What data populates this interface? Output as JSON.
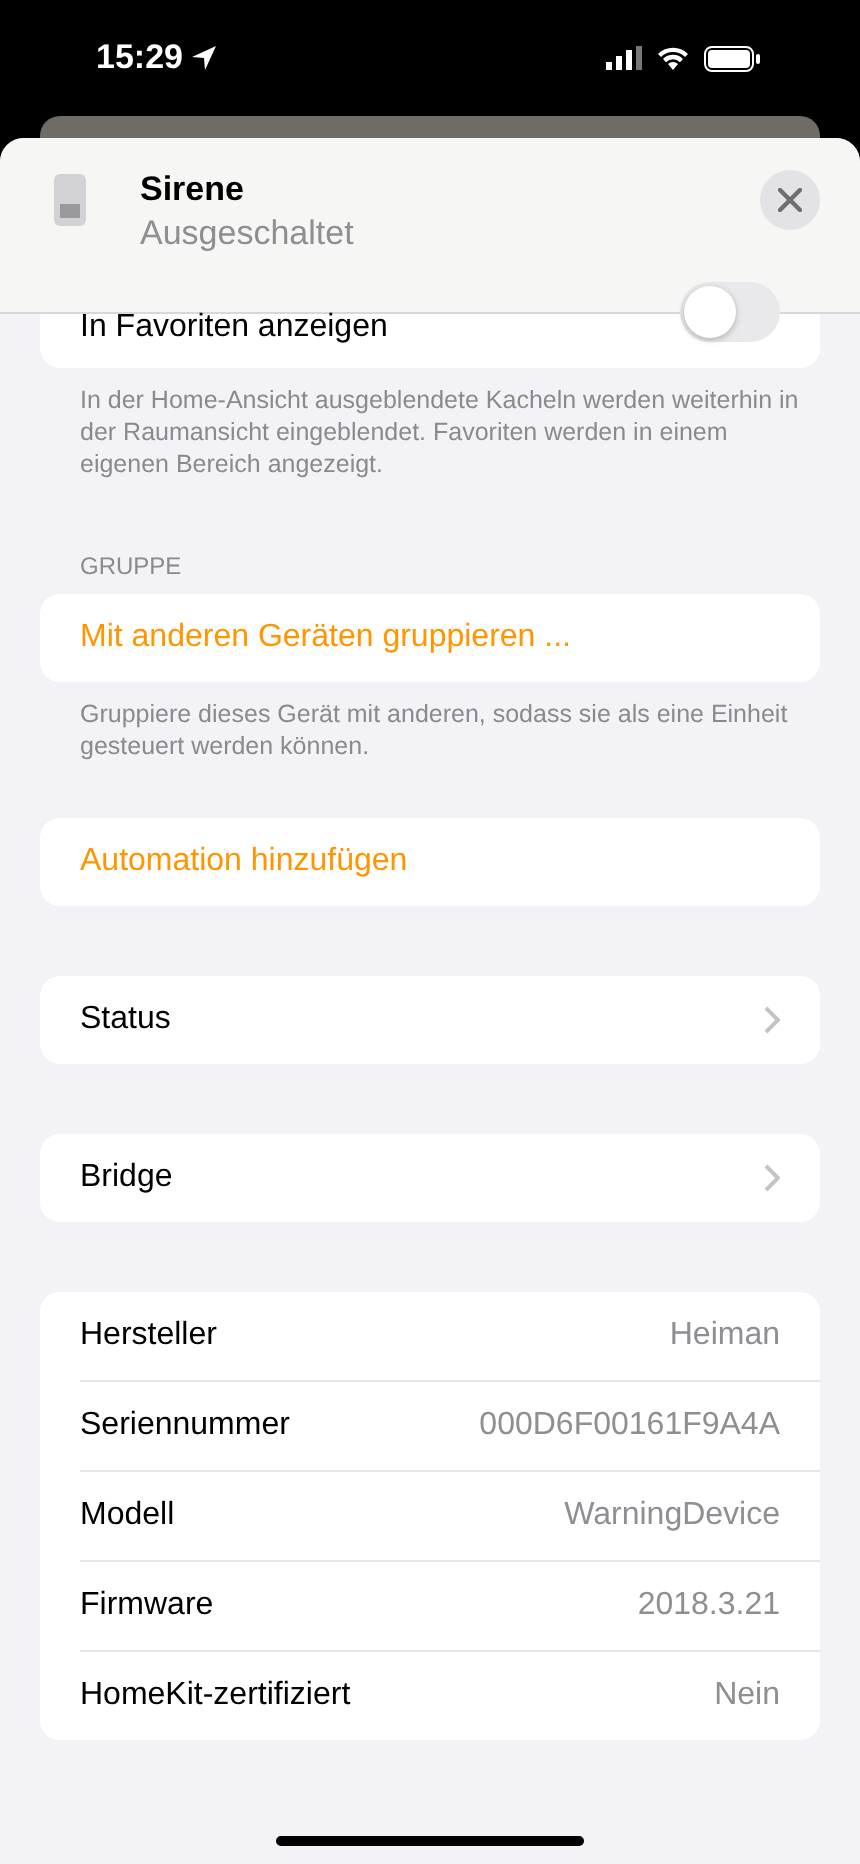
{
  "status_bar": {
    "time": "15:29"
  },
  "header": {
    "title": "Sirene",
    "subtitle": "Ausgeschaltet"
  },
  "favorites": {
    "label": "In Favoriten anzeigen",
    "on": false,
    "footnote": "In der Home-Ansicht ausgeblendete Kacheln werden weiterhin in der Raumansicht eingeblendet. Favoriten werden in einem eigenen Bereich angezeigt."
  },
  "group": {
    "heading": "GRUPPE",
    "action": "Mit anderen Geräten gruppieren ...",
    "footnote": "Gruppiere dieses Gerät mit anderen, sodass sie als eine Einheit gesteuert werden können."
  },
  "automation": {
    "action": "Automation hinzufügen"
  },
  "links": [
    {
      "label": "Status"
    },
    {
      "label": "Bridge"
    }
  ],
  "info": [
    {
      "label": "Hersteller",
      "value": "Heiman"
    },
    {
      "label": "Seriennummer",
      "value": "000D6F00161F9A4A"
    },
    {
      "label": "Modell",
      "value": "WarningDevice"
    },
    {
      "label": "Firmware",
      "value": "2018.3.21"
    },
    {
      "label": "HomeKit-zertifiziert",
      "value": "Nein"
    }
  ]
}
